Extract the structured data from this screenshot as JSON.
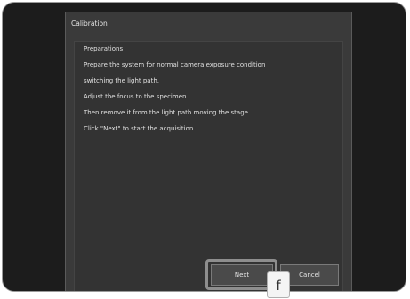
{
  "dialog": {
    "title": "Calibration",
    "heading": "Preparations",
    "lines": [
      "Prepare the system for normal camera exposure condition",
      "switching the light path.",
      "Adjust the focus to the specimen.",
      "Then remove it from the light path moving the stage.",
      "Click \"Next\" to start the acquisition."
    ]
  },
  "buttons": {
    "next_label": "Next",
    "cancel_label": "Cancel"
  },
  "callout": {
    "label": "f"
  }
}
